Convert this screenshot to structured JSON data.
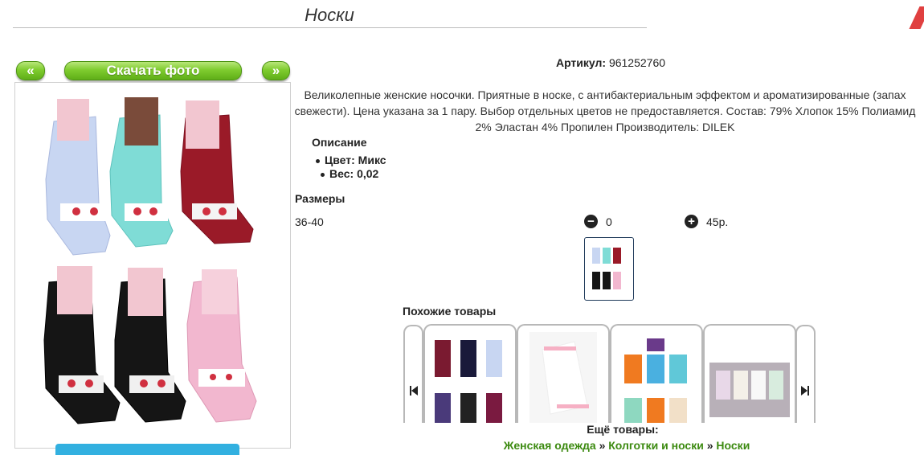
{
  "page": {
    "title": "Носки"
  },
  "gallery": {
    "prev_label": "«",
    "download_label": "Скачать фото",
    "next_label": "»"
  },
  "product": {
    "article_label": "Артикул:",
    "article_value": "961252760",
    "description": "Великолепные женские носочки. Приятные в носке, с антибактериальным эффектом и ароматизированные (запах свежести). Цена указана за 1 пару. Выбор отдельных цветов не предоставляется. Состав: 79% Хлопок 15% Полиамид 2% Эластан 4% Пропилен Производитель: DILEK",
    "description_heading": "Описание",
    "attributes": [
      {
        "label": "Цвет:",
        "value": "Микс"
      },
      {
        "label": "Вес:",
        "value": "0,02"
      }
    ]
  },
  "sizes": {
    "heading": "Размеры",
    "items": [
      {
        "size": "36-40",
        "qty": "0",
        "price": "45р."
      }
    ]
  },
  "related": {
    "heading": "Похожие товары",
    "more_label": "Ещё товары:",
    "breadcrumbs": [
      "Женская одежда",
      "Колготки и носки",
      "Носки"
    ],
    "separator": "»"
  },
  "colors": {
    "accent_green": "#3c8a10",
    "button_green": "#7fcc2f",
    "tab_blue": "#32b0e0"
  }
}
